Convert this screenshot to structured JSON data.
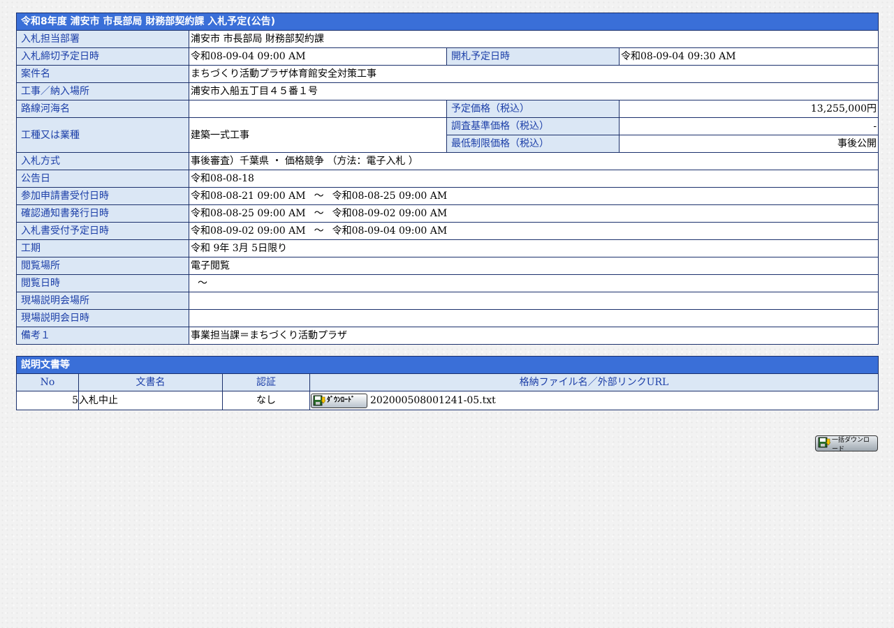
{
  "notice": {
    "title": "令和8年度 浦安市 市長部局 財務部契約課 入札予定(公告)",
    "rows": {
      "dept": {
        "label": "入札担当部署",
        "value": "浦安市 市長部局 財務部契約課"
      },
      "deadline": {
        "label": "入札締切予定日時",
        "value": "令和08-09-04 09:00 AM"
      },
      "opening": {
        "label": "開札予定日時",
        "value": "令和08-09-04 09:30 AM"
      },
      "case_name": {
        "label": "案件名",
        "value": "まちづくり活動プラザ体育館安全対策工事"
      },
      "place": {
        "label": "工事／納入場所",
        "value": "浦安市入船五丁目４５番１号"
      },
      "route": {
        "label": "路線河海名",
        "value": ""
      },
      "planned_price": {
        "label": "予定価格（税込）",
        "value": "13,255,000円"
      },
      "work_type": {
        "label": "工種又は業種",
        "value": "建築一式工事"
      },
      "survey_price": {
        "label": "調査基準価格（税込）",
        "value": "-"
      },
      "min_price": {
        "label": "最低制限価格（税込）",
        "value": "事後公開"
      },
      "method": {
        "label": "入札方式",
        "value": "事後審査）千葉県 ・ 価格競争 （方法：電子入札 ）"
      },
      "announce_date": {
        "label": "公告日",
        "value": "令和08-08-18"
      },
      "application": {
        "label": "参加申請書受付日時",
        "from": "令和08-08-21 09:00 AM",
        "sep": "～",
        "to": "令和08-08-25 09:00 AM"
      },
      "confirmation": {
        "label": "確認通知書発行日時",
        "from": "令和08-08-25 09:00 AM",
        "sep": "～",
        "to": "令和08-09-02 09:00 AM"
      },
      "bid_receipt": {
        "label": "入札書受付予定日時",
        "from": "令和08-09-02 09:00 AM",
        "sep": "～",
        "to": "令和08-09-04 09:00 AM"
      },
      "period": {
        "label": "工期",
        "value": "令和 9年 3月 5日限り"
      },
      "viewing_place": {
        "label": "閲覧場所",
        "value": "電子閲覧"
      },
      "viewing_date": {
        "label": "閲覧日時",
        "value": "～"
      },
      "briefing_place": {
        "label": "現場説明会場所",
        "value": ""
      },
      "briefing_date": {
        "label": "現場説明会日時",
        "value": ""
      },
      "remarks1": {
        "label": "備考１",
        "value": "事業担当課＝まちづくり活動プラザ"
      }
    }
  },
  "documents": {
    "title": "説明文書等",
    "columns": [
      "No",
      "文書名",
      "認証",
      "格納ファイル名／外部リンクURL"
    ],
    "rows": [
      {
        "no": "5",
        "name": "入札中止",
        "auth": "なし",
        "button": "ﾀﾞｳﾝﾛｰﾄﾞ",
        "file": "202000508001241-05.txt"
      }
    ]
  },
  "bulk_download": {
    "label": "一括ダウンロード"
  },
  "colors": {
    "header_bg": "#3a6fd8",
    "label_bg": "#dbe7f5",
    "label_text": "#1c3fa8",
    "border": "#1a2f6b"
  },
  "icons": {
    "download": "floppy-download-icon"
  }
}
